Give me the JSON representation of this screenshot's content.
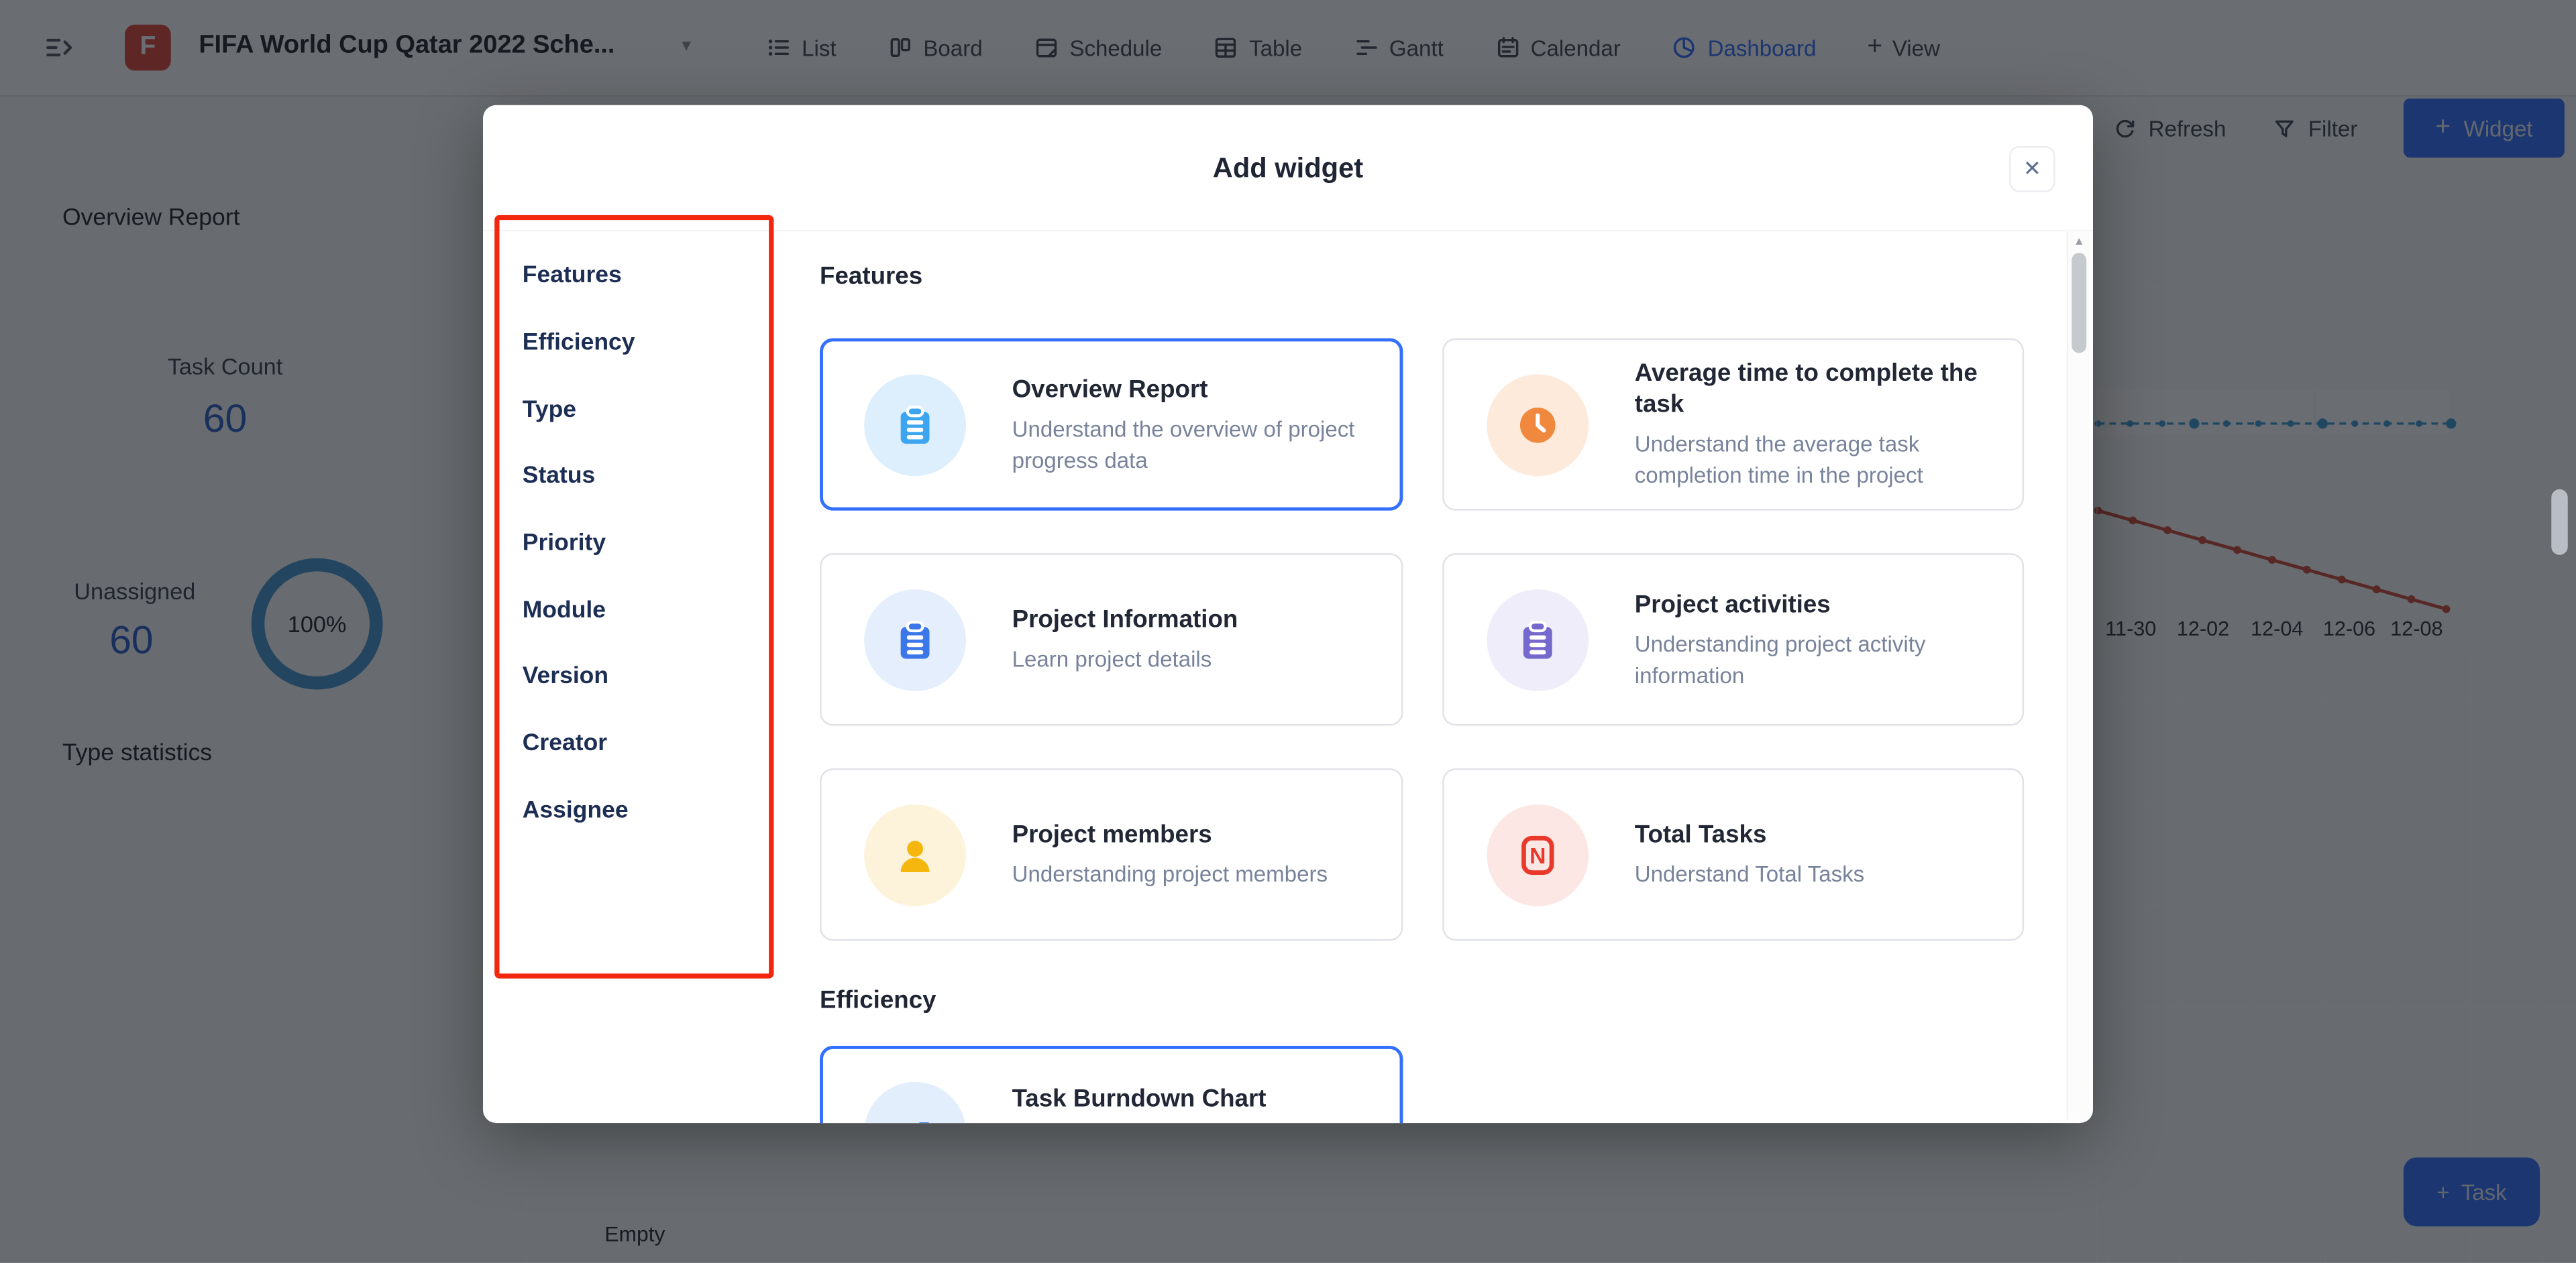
{
  "topbar": {
    "logo_letter": "F",
    "project_title": "FIFA World Cup Qatar 2022 Sche...",
    "tabs": [
      {
        "label": "List"
      },
      {
        "label": "Board"
      },
      {
        "label": "Schedule"
      },
      {
        "label": "Table"
      },
      {
        "label": "Gantt"
      },
      {
        "label": "Calendar"
      },
      {
        "label": "Dashboard"
      },
      {
        "label": "View"
      }
    ],
    "active_tab": "Dashboard"
  },
  "toolbar": {
    "refresh_label": "Refresh",
    "filter_label": "Filter",
    "widget_plus": "+",
    "widget_label": "Widget"
  },
  "dashboard": {
    "overview_title": "Overview Report",
    "task_count_label": "Task Count",
    "task_count_value": "60",
    "unassigned_label": "Unassigned",
    "unassigned_value": "60",
    "donut_percent": "100%",
    "donut_color": "#4596d2",
    "type_stats_title": "Type statistics",
    "empty_label": "Empty",
    "task_button_plus": "+",
    "task_button_label": "Task",
    "accent_color": "#3370ff",
    "burndown": {
      "type": "line",
      "x_labels": [
        "11-30",
        "12-02",
        "12-04",
        "12-06",
        "12-08"
      ],
      "series": [
        {
          "name": "upper-flat-dashed",
          "color": "#3e9bd6",
          "style": "dashed",
          "marker_count": 12
        },
        {
          "name": "declining",
          "color": "#d04b3c",
          "style": "solid",
          "marker_count": 11
        }
      ]
    }
  },
  "modal": {
    "title": "Add widget",
    "close_glyph": "✕",
    "sidebar": [
      "Features",
      "Efficiency",
      "Type",
      "Status",
      "Priority",
      "Module",
      "Version",
      "Creator",
      "Assignee"
    ],
    "sections": [
      {
        "heading": "Features",
        "cards": [
          {
            "title": "Overview Report",
            "desc": "Understand the overview of project progress data",
            "icon": "clipboard",
            "color": "#3da5f0",
            "bg": "#ddeffc",
            "selected": true
          },
          {
            "title": "Average time to complete the task",
            "desc": "Understand the average task completion time in the project",
            "icon": "clock",
            "color": "#f0883d",
            "bg": "#fdeadb",
            "selected": false
          },
          {
            "title": "Project Information",
            "desc": "Learn project details",
            "icon": "clipboard",
            "color": "#3b77e8",
            "bg": "#e4eefc",
            "selected": false
          },
          {
            "title": "Project activities",
            "desc": "Understanding project activity information",
            "icon": "clipboard",
            "color": "#7569cd",
            "bg": "#efedf9",
            "selected": false
          },
          {
            "title": "Project members",
            "desc": "Understanding project members",
            "icon": "person",
            "color": "#f5b70d",
            "bg": "#fdf3da",
            "selected": false
          },
          {
            "title": "Total Tasks",
            "desc": "Understand Total Tasks",
            "icon": "n-badge",
            "color": "#e8392b",
            "bg": "#fde7e4",
            "selected": false
          }
        ]
      },
      {
        "heading": "Efficiency",
        "cards": [
          {
            "title": "Task Burndown Chart",
            "icon": "trend",
            "color": "#3f8df2",
            "bg": "#e2eefc",
            "selected": true
          }
        ]
      }
    ]
  },
  "annotation": {
    "color": "#f2270d"
  }
}
